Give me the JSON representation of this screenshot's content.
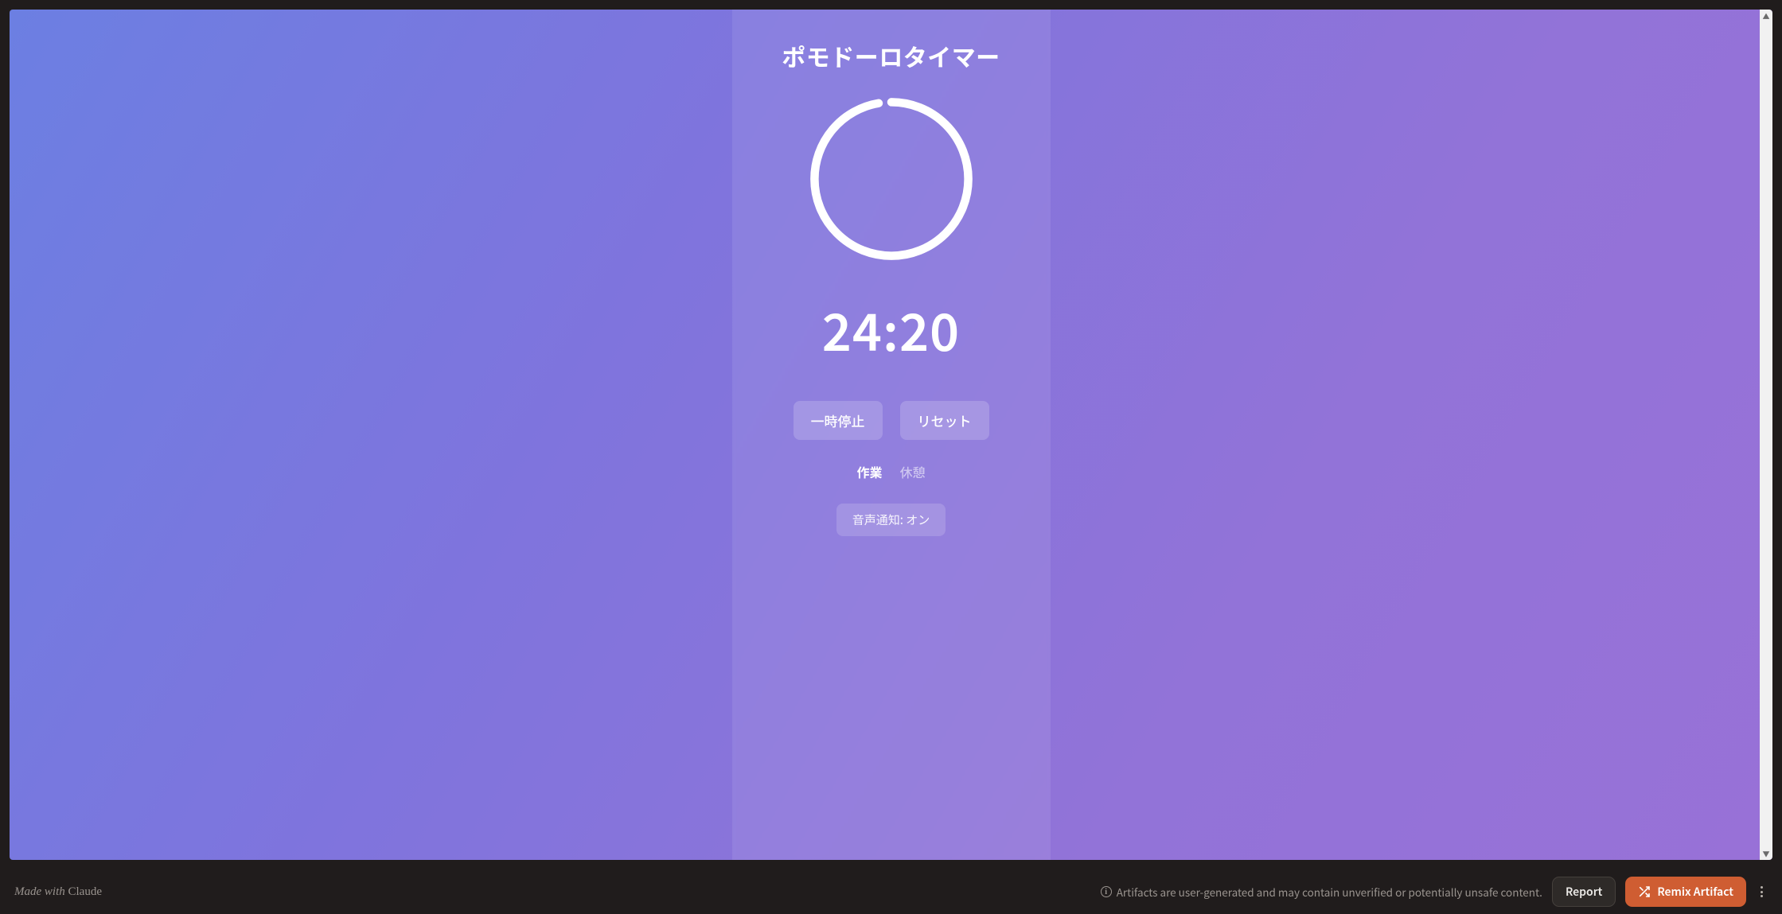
{
  "app": {
    "title": "ポモドーロタイマー",
    "time": "24:20",
    "progress_fraction": 0.973,
    "buttons": {
      "pause": "一時停止",
      "reset": "リセット"
    },
    "modes": {
      "work": "作業",
      "break": "休憩",
      "active": "work"
    },
    "sound_toggle": "音声通知: オン"
  },
  "footer": {
    "made_with_prefix": "Made with ",
    "made_with_brand": "Claude",
    "warning": "Artifacts are user-generated and may contain unverified or potentially unsafe content.",
    "report": "Report",
    "remix": "Remix Artifact"
  }
}
